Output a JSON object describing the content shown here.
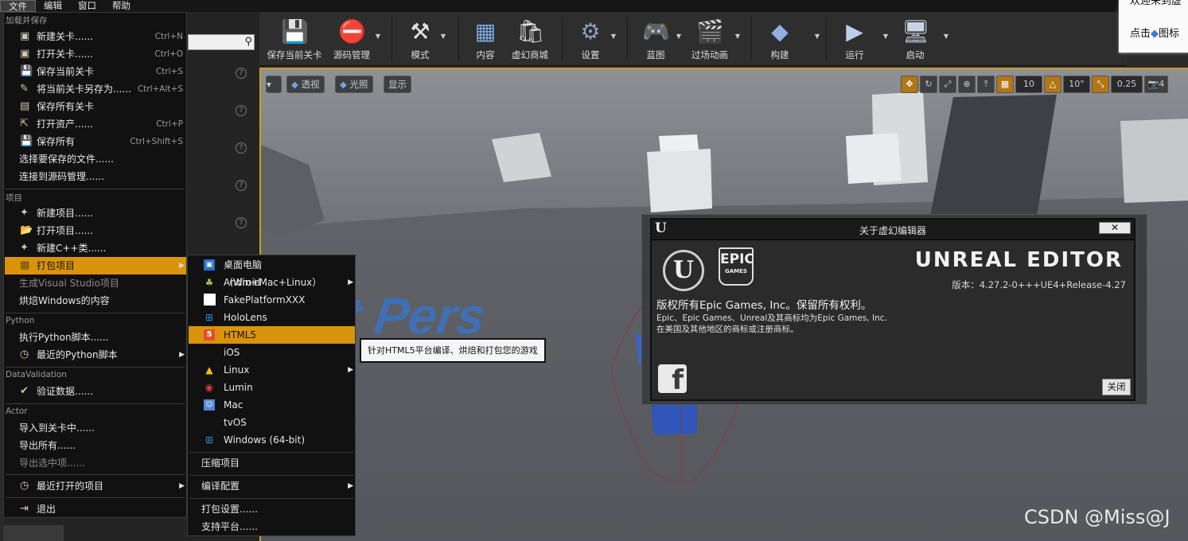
{
  "menubar": {
    "items": [
      "文件",
      "编辑",
      "窗口",
      "帮助"
    ]
  },
  "toolbar": {
    "buttons": [
      {
        "label": "保存当前关卡",
        "icon": "save-icon"
      },
      {
        "label": "源码管理",
        "icon": "source-control-icon"
      },
      {
        "label": "模式",
        "icon": "modes-icon"
      },
      {
        "label": "内容",
        "icon": "content-icon"
      },
      {
        "label": "虚幻商城",
        "icon": "marketplace-icon"
      },
      {
        "label": "设置",
        "icon": "settings-icon"
      },
      {
        "label": "蓝图",
        "icon": "blueprint-icon"
      },
      {
        "label": "过场动画",
        "icon": "cinematics-icon"
      },
      {
        "label": "构建",
        "icon": "build-icon"
      },
      {
        "label": "运行",
        "icon": "play-icon"
      },
      {
        "label": "启动",
        "icon": "launch-icon"
      }
    ]
  },
  "welcome": {
    "line1": "欢迎来到虚",
    "line2": "点击",
    "line2b": "图标"
  },
  "viewport": {
    "perspective": "透视",
    "lit": "光照",
    "show": "显示",
    "grid_snap": "10",
    "rot_snap": "10°",
    "scale_snap": "0.25",
    "cam_speed": "4",
    "floor_text": "st Pers"
  },
  "file_menu": {
    "sections": {
      "load_save": "加载并保存",
      "project": "项目",
      "python": "Python",
      "data_validation": "DataValidation",
      "actor": "Actor"
    },
    "items": {
      "new_level": {
        "label": "新建关卡......",
        "shortcut": "Ctrl+N"
      },
      "open_level": {
        "label": "打开关卡......",
        "shortcut": "Ctrl+O"
      },
      "save_current": {
        "label": "保存当前关卡",
        "shortcut": "Ctrl+S"
      },
      "save_level_as": {
        "label": "将当前关卡另存为......",
        "shortcut": "Ctrl+Alt+S"
      },
      "save_all_levels": {
        "label": "保存所有关卡",
        "shortcut": ""
      },
      "open_asset": {
        "label": "打开资产......",
        "shortcut": "Ctrl+P"
      },
      "save_all": {
        "label": "保存所有",
        "shortcut": "Ctrl+Shift+S"
      },
      "choose_files": {
        "label": "选择要保存的文件......",
        "shortcut": ""
      },
      "connect_sc": {
        "label": "连接到源码管理......",
        "shortcut": ""
      },
      "new_project": {
        "label": "新建项目......"
      },
      "open_project": {
        "label": "打开项目......"
      },
      "new_cpp": {
        "label": "新建C++类......"
      },
      "package_project": {
        "label": "打包项目"
      },
      "gen_vs": {
        "label": "生成Visual Studio项目"
      },
      "cook_windows": {
        "label": "烘焙Windows的内容"
      },
      "exec_python": {
        "label": "执行Python脚本......"
      },
      "recent_python": {
        "label": "最近的Python脚本"
      },
      "validate_data": {
        "label": "验证数据......"
      },
      "import_level": {
        "label": "导入到关卡中......"
      },
      "export_all": {
        "label": "导出所有......"
      },
      "export_selected": {
        "label": "导出选中项......"
      },
      "recent_projects": {
        "label": "最近打开的项目"
      },
      "exit": {
        "label": "退出"
      }
    }
  },
  "package_menu": {
    "items": [
      {
        "label": "桌面电脑（Win+Mac+Linux）",
        "icon": "desktop-icon"
      },
      {
        "label": "Android",
        "icon": "android-icon",
        "arrow": true
      },
      {
        "label": "FakePlatformXXX",
        "icon": "blank-icon"
      },
      {
        "label": "HoloLens",
        "icon": "windows-icon"
      },
      {
        "label": "HTML5",
        "icon": "html5-icon",
        "highlight": true
      },
      {
        "label": "iOS",
        "icon": "apple-icon"
      },
      {
        "label": "Linux",
        "icon": "linux-icon",
        "arrow": true
      },
      {
        "label": "Lumin",
        "icon": "lumin-icon"
      },
      {
        "label": "Mac",
        "icon": "mac-icon"
      },
      {
        "label": "tvOS",
        "icon": "apple-icon"
      },
      {
        "label": "Windows (64-bit)",
        "icon": "windows-icon"
      }
    ],
    "zip": "压缩项目",
    "build_config": "编译配置",
    "packaging_settings": "打包设置......",
    "supported_platforms": "支持平台......"
  },
  "tooltip": "针对HTML5平台编译、烘焙和打包您的游戏",
  "about": {
    "title": "关于虚幻编辑器",
    "brand": "UNREAL EDITOR",
    "epic_line1": "EPIC",
    "epic_line2": "GAMES",
    "version": "版本：4.27.2-0+++UE4+Release-4.27",
    "copyright": "版权所有Epic Games, Inc。保留所有权利。",
    "trademark1": "Epic、Epic Games、Unreal及其商标均为Epic Games, Inc.",
    "trademark2": "在美国及其他地区的商标或注册商标。",
    "close": "关闭"
  },
  "watermark": "CSDN @Miss@J"
}
